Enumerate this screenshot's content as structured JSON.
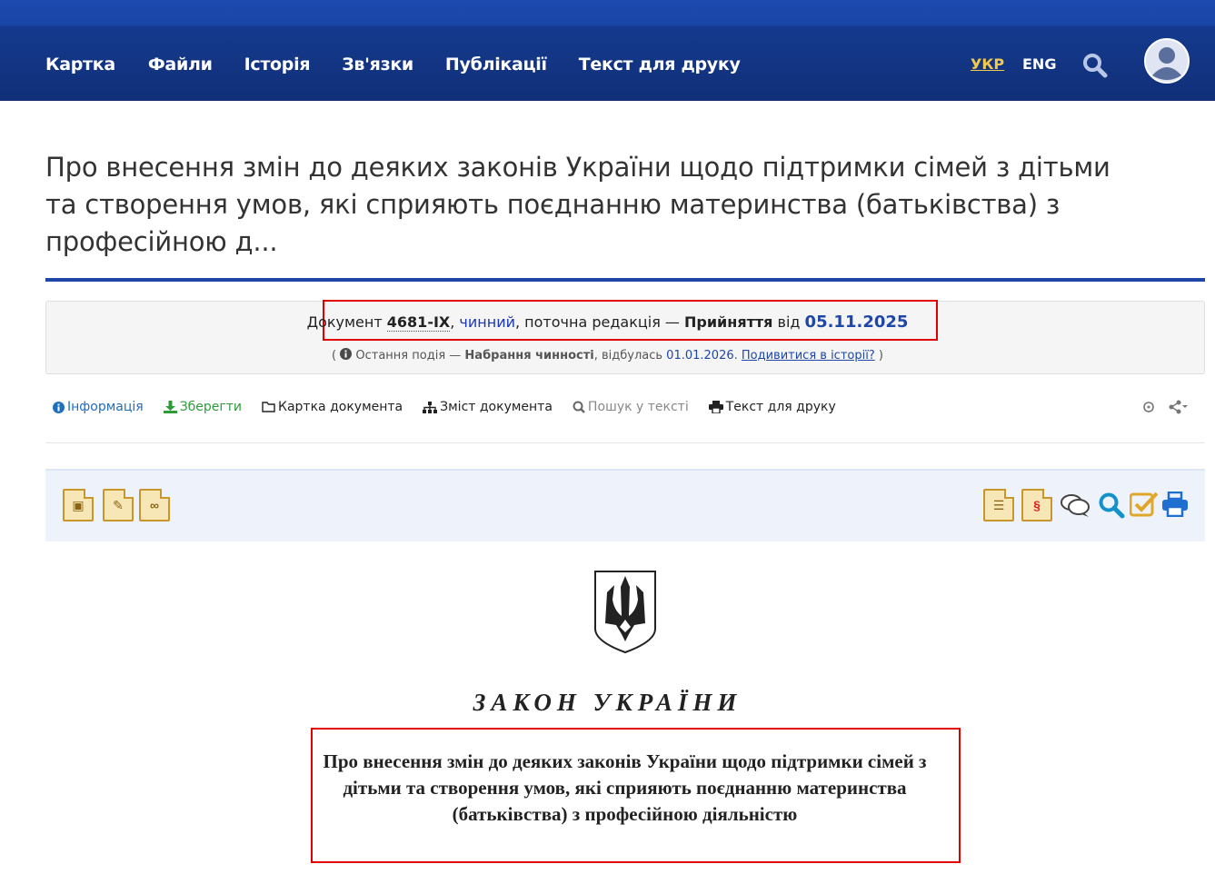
{
  "nav": {
    "items": [
      "Картка",
      "Файли",
      "Історія",
      "Зв'язки",
      "Публікації",
      "Текст для друку"
    ],
    "lang_ukr": "УКР",
    "lang_eng": "ENG"
  },
  "document": {
    "page_title": "Про внесення змін до деяких законів України щодо підтримки сімей з дітьми та створення умов, які сприяють поєднанню материнства (батьківства) з професійною д...",
    "status": {
      "prefix": "Документ",
      "number": "4681-IX",
      "state": "чинний",
      "edition_text": ", поточна редакція — ",
      "edition_type": "Прийняття",
      "from": "від",
      "date": "05.11.2025"
    },
    "last_event": {
      "label": "Остання подія —",
      "event": "Набрання чинності",
      "happened": ", відбулась",
      "date": "01.01.2026",
      "history_link": "Подивитися в історії?"
    }
  },
  "toolbar": {
    "info": "Інформація",
    "save": "Зберегти",
    "card": "Картка документа",
    "contents": "Зміст документа",
    "search": "Пошук у тексті",
    "print": "Текст для друку"
  },
  "law": {
    "heading": "ЗАКОН УКРАЇНИ",
    "title": "Про внесення змін до деяких законів України щодо підтримки сімей з дітьми та створення умов, які сприяють поєднанню материнства (батьківства) з професійною діяльністю"
  },
  "colors": {
    "header_blue": "#112f78",
    "accent_blue": "#1f47a8",
    "highlight_red": "#e00000",
    "ukr_yellow": "#f2c94c"
  }
}
